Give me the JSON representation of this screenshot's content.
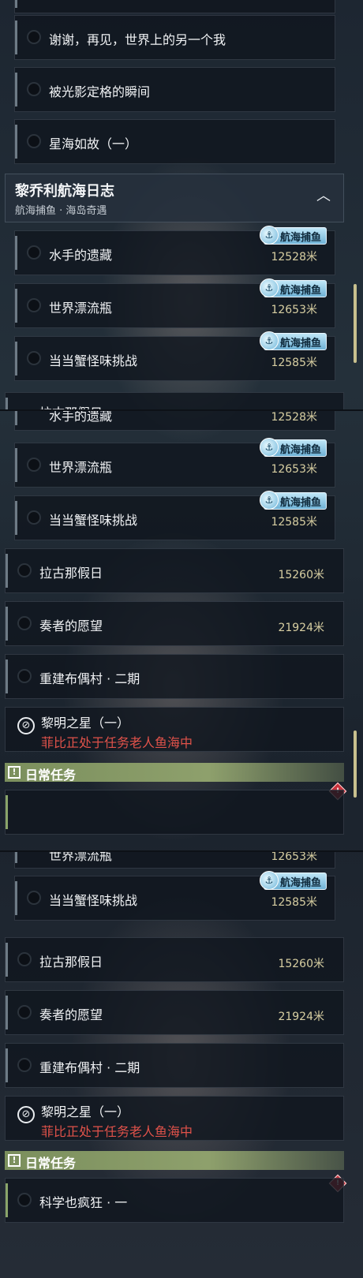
{
  "tag_label": "航海捕鱼",
  "section": {
    "title": "黎乔利航海日志",
    "subtitle": "航海捕鱼 · 海岛奇遇"
  },
  "daily_section": {
    "title": "日常任务"
  },
  "top_quests": [
    {
      "label": "谢谢，再见，世界上的另一个我"
    },
    {
      "label": "被光影定格的瞬间"
    },
    {
      "label": "星海如故（一）"
    }
  ],
  "voyage_quests": [
    {
      "label": "水手的遗藏",
      "distance": "12528米",
      "tag": "航海捕鱼"
    },
    {
      "label": "世界漂流瓶",
      "distance": "12653米",
      "tag": "航海捕鱼"
    },
    {
      "label": "当当蟹怪味挑战",
      "distance": "12585米",
      "tag": "航海捕鱼"
    }
  ],
  "other_quests": [
    {
      "label": "拉古那假日",
      "distance": "15260米"
    },
    {
      "label": "奏者的愿望",
      "distance": "21924米"
    },
    {
      "label": "重建布偶村 · 二期",
      "distance": ""
    }
  ],
  "dawn_quest": {
    "title": "黎明之星（一）",
    "warning": "菲比正处于任务老人鱼海中"
  },
  "daily_quests": [
    {
      "label": "科学也疯狂 · 一"
    }
  ],
  "partial_labels": {
    "seg1_bottom": "拉古那假日",
    "seg2_top": "水手的遗藏",
    "seg2_top_dist": "12528米",
    "seg3_top": "世界漂流瓶",
    "seg3_top_dist": "12653米"
  },
  "icons": {
    "empty_circle": "empty-circle-icon",
    "collapse": "chevron-up-icon",
    "fishing": "fishing-badge-icon",
    "blocked": "blocked-icon",
    "alert": "alert-square-icon",
    "new": "red-diamond-icon"
  },
  "colors": {
    "distance": "#d8cfa2",
    "warning": "#e0524a",
    "daily_bar": "#8aa56a",
    "tag": "#6fb2d6"
  }
}
